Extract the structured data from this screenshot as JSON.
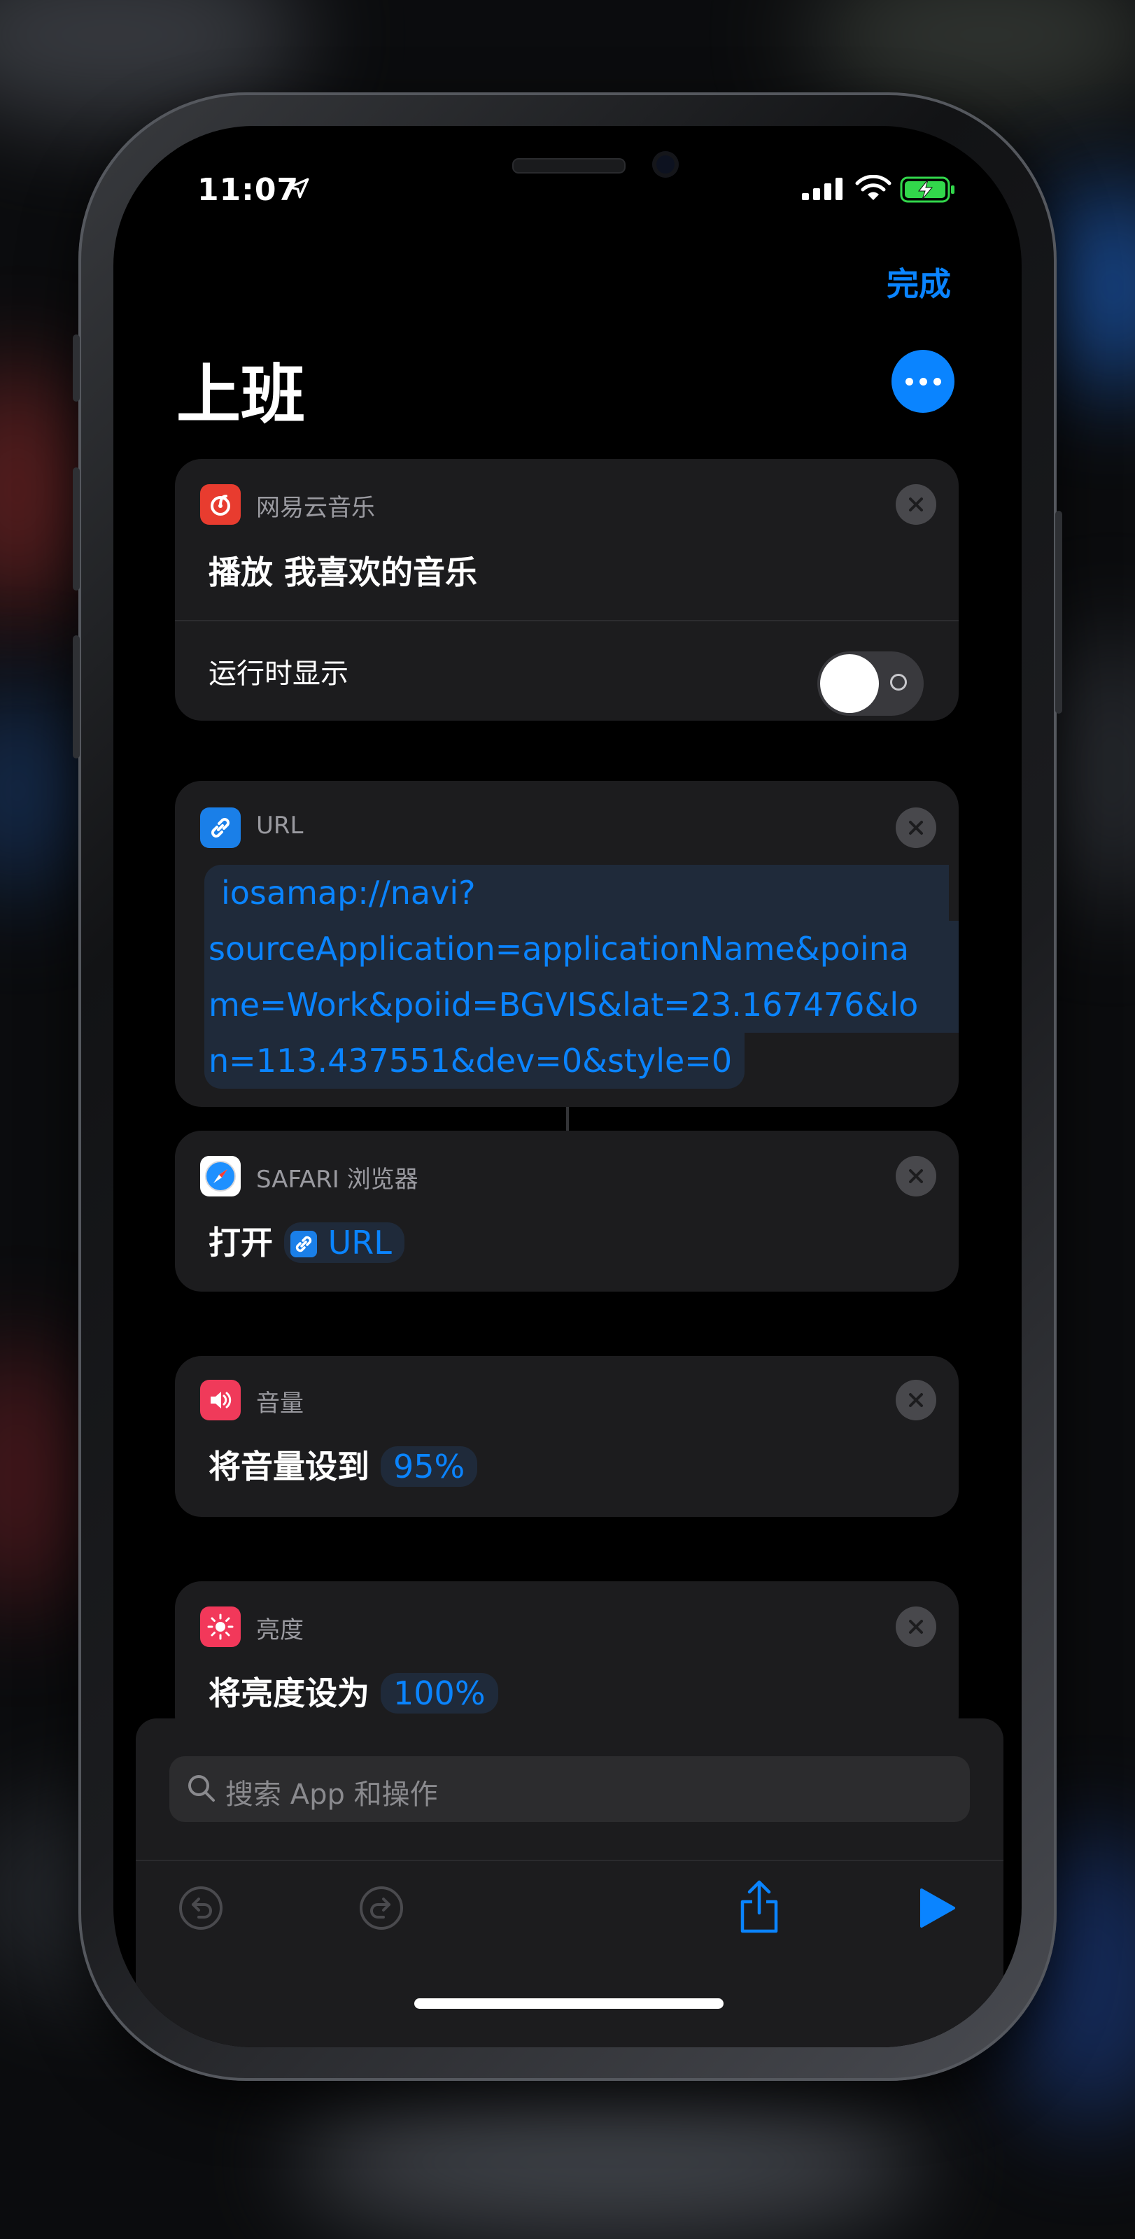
{
  "status_bar": {
    "time": "11:07"
  },
  "header": {
    "done_label": "完成",
    "title": "上班"
  },
  "cards": [
    {
      "app_name": "网易云音乐",
      "action_prefix": "播放",
      "action_value": "我喜欢的音乐",
      "option_label": "运行时显示",
      "option_enabled": false
    },
    {
      "app_name": "URL",
      "url_lines": [
        "iosamap://navi?",
        "sourceApplication=applicationName&poina",
        "me=Work&poiid=BGVIS&lat=23.167476&lo",
        "n=113.437551&dev=0&style=0"
      ]
    },
    {
      "app_name": "SAFARI 浏览器",
      "action_prefix": "打开",
      "action_value": "URL"
    },
    {
      "app_name": "音量",
      "action_prefix": "将音量设到",
      "action_value": "95%"
    },
    {
      "app_name": "亮度",
      "action_prefix": "将亮度设为",
      "action_value": "100%"
    }
  ],
  "search": {
    "placeholder": "搜索 App 和操作"
  },
  "colors": {
    "accent": "#0a84ff",
    "netease_red": "#e83c2f",
    "url_blue": "#1a7fe8",
    "volume_pink": "#f03a5a",
    "brightness_pink": "#f2385a",
    "battery_green": "#32d74b"
  },
  "icons": {
    "location": "location-arrow-icon",
    "signal": "cellular-signal-icon",
    "wifi": "wifi-icon",
    "battery": "battery-charging-icon",
    "more": "ellipsis-icon",
    "netease": "netease-music-icon",
    "url": "link-icon",
    "safari": "safari-compass-icon",
    "volume": "speaker-icon",
    "brightness": "sun-icon",
    "close": "close-x-icon",
    "search": "magnifier-icon",
    "undo": "undo-icon",
    "redo": "redo-icon",
    "share": "share-icon",
    "play": "play-icon"
  }
}
